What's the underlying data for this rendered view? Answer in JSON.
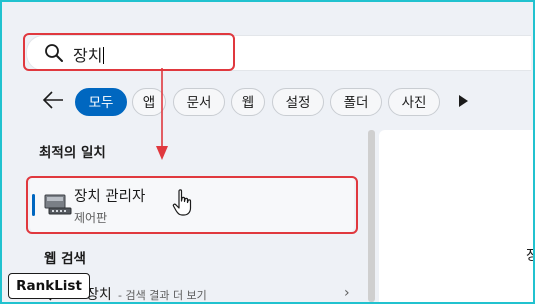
{
  "search": {
    "query": "장치"
  },
  "filters": {
    "chips": [
      "모두",
      "앱",
      "문서",
      "웹",
      "설정",
      "폴더",
      "사진"
    ],
    "active_index": 0
  },
  "best_match": {
    "heading": "최적의 일치",
    "title": "장치 관리자",
    "subtitle": "제어판",
    "icon": "device-manager-icon"
  },
  "web_search": {
    "heading": "웹 검색",
    "term": "장치",
    "hint": "- 검색 결과 더 보기"
  },
  "right_pane": {
    "partial_text": "장"
  },
  "badge": {
    "label": "RankList"
  },
  "colors": {
    "accent": "#0067c0",
    "highlight": "#e0383e",
    "frame": "#21c2cf"
  }
}
